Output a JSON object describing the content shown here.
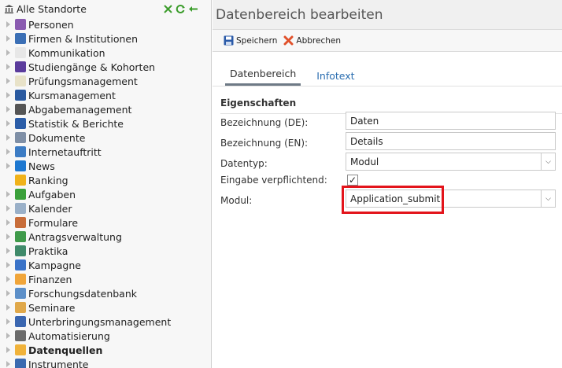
{
  "tree": {
    "root_label": "Alle Standorte",
    "items": [
      {
        "label": "Personen",
        "icon": "people-icon",
        "color": "#8a5bb0"
      },
      {
        "label": "Firmen & Institutionen",
        "icon": "factory-icon",
        "color": "#3b6fb5"
      },
      {
        "label": "Kommunikation",
        "icon": "envelope-icon",
        "color": "#e7e7e7"
      },
      {
        "label": "Studiengänge & Kohorten",
        "icon": "feather-icon",
        "color": "#5b3c9c"
      },
      {
        "label": "Prüfungsmanagement",
        "icon": "checklist-icon",
        "color": "#e8e2c8"
      },
      {
        "label": "Kursmanagement",
        "icon": "book-icon",
        "color": "#2a5aa0"
      },
      {
        "label": "Abgabemanagement",
        "icon": "inbox-icon",
        "color": "#555555"
      },
      {
        "label": "Statistik & Berichte",
        "icon": "bar-chart-icon",
        "color": "#2b5da8"
      },
      {
        "label": "Dokumente",
        "icon": "folder-icon",
        "color": "#7f8fa6"
      },
      {
        "label": "Internetauftritt",
        "icon": "globe-icon",
        "color": "#3c7cc4"
      },
      {
        "label": "News",
        "icon": "info-icon",
        "color": "#1e78d0"
      },
      {
        "label": "Ranking",
        "icon": "star-icon",
        "color": "#f0b21a"
      },
      {
        "label": "Aufgaben",
        "icon": "refresh-check-icon",
        "color": "#3aa03a"
      },
      {
        "label": "Kalender",
        "icon": "calendar-icon",
        "color": "#9ab0c8"
      },
      {
        "label": "Formulare",
        "icon": "form-icon",
        "color": "#c86d3a"
      },
      {
        "label": "Antragsverwaltung",
        "icon": "application-icon",
        "color": "#3f9a4a"
      },
      {
        "label": "Praktika",
        "icon": "grid-icon",
        "color": "#3f8a6a"
      },
      {
        "label": "Kampagne",
        "icon": "gift-icon",
        "color": "#3a73c8"
      },
      {
        "label": "Finanzen",
        "icon": "coins-icon",
        "color": "#f0a53a"
      },
      {
        "label": "Forschungsdatenbank",
        "icon": "research-icon",
        "color": "#5c8fc8"
      },
      {
        "label": "Seminare",
        "icon": "briefcase-icon",
        "color": "#e0a84a"
      },
      {
        "label": "Unterbringungsmanagement",
        "icon": "building-icon",
        "color": "#3a66b0"
      },
      {
        "label": "Automatisierung",
        "icon": "gear-icon",
        "color": "#6a6a6a"
      },
      {
        "label": "Datenquellen",
        "icon": "database-icon",
        "color": "#f0b23a"
      },
      {
        "label": "Instrumente",
        "icon": "instrument-icon",
        "color": "#3a6ab0"
      }
    ]
  },
  "header": {
    "title": "Datenbereich bearbeiten"
  },
  "toolbar": {
    "save_label": "Speichern",
    "cancel_label": "Abbrechen"
  },
  "tabs": [
    {
      "label": "Datenbereich"
    },
    {
      "label": "Infotext"
    }
  ],
  "section": {
    "title": "Eigenschaften"
  },
  "form": {
    "name_de_label": "Bezeichnung (DE):",
    "name_de_value": "Daten",
    "name_en_label": "Bezeichnung (EN):",
    "name_en_value": "Details",
    "datatype_label": "Datentyp:",
    "datatype_value": "Modul",
    "required_label": "Eingabe verpflichtend:",
    "required_checked": true,
    "module_label": "Modul:",
    "module_value": "Application_submit"
  },
  "colors": {
    "highlight": "#e3141b",
    "tab_link": "#2a6db0"
  }
}
